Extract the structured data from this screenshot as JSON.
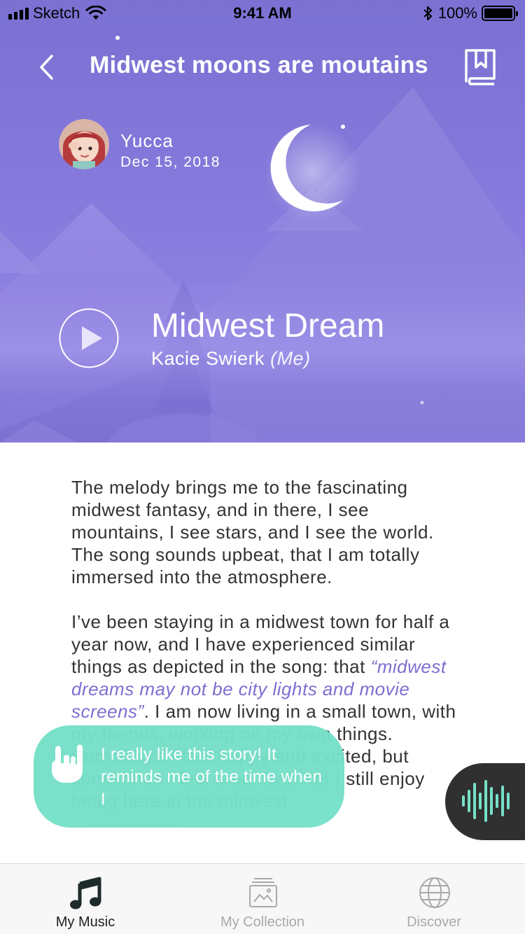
{
  "status_bar": {
    "carrier": "Sketch",
    "time": "9:41 AM",
    "battery": "100%"
  },
  "nav": {
    "title": "Midwest moons are moutains",
    "back_icon": "chevron-left-icon",
    "bookmark_icon": "bookmark-book-icon"
  },
  "author": {
    "name": "Yucca",
    "date": "Dec 15, 2018"
  },
  "song": {
    "title": "Midwest Dream",
    "artist": "Kacie Swierk",
    "artist_note": "(Me)"
  },
  "story": {
    "paragraph_1": "The melody brings me to the fascinating midwest fantasy, and in there, I see mountains, I see stars, and I see the world. The song sounds upbeat, that I am totally immersed into the atmosphere.",
    "paragraph_2_before": "I’ve been staying in a midwest town for half a year now, and I have experienced similar things as depicted in the song: that ",
    "paragraph_2_quote": "“midwest dreams may not be city lights and movie screens”",
    "paragraph_2_after": ". I am now living in a small town, with my friends, working on my own things. Sometimes I feel happy and excited, but sometimes I feel tired, lost. Yet I still enjoy being here in the midwest."
  },
  "comment": {
    "text": "I really like this story! It reminds me of the time when I",
    "icon": "rock-hand-icon"
  },
  "voice_button": {
    "icon": "sound-wave-icon"
  },
  "tabs": [
    {
      "label": "My Music",
      "icon": "music-note-icon",
      "active": true
    },
    {
      "label": "My Collection",
      "icon": "collection-box-icon",
      "active": false
    },
    {
      "label": "Discover",
      "icon": "globe-icon",
      "active": false
    }
  ],
  "colors": {
    "hero": "#8478db",
    "accent_quote": "#7b6fd0",
    "comment_bubble": "#76e0c8",
    "voice_button": "#2f302f",
    "voice_wave": "#76e0c8"
  }
}
